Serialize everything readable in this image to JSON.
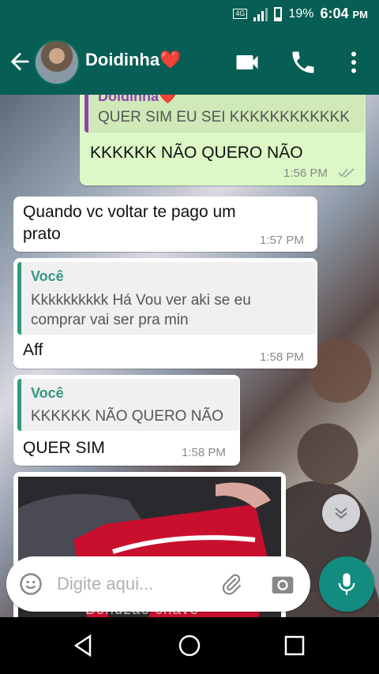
{
  "status_bar": {
    "network": "4G",
    "battery": "19%",
    "time": "6:04",
    "ampm": "PM"
  },
  "header": {
    "contact_name": "Doidinha❤️"
  },
  "messages": [
    {
      "type": "outgoing",
      "quote_author": "Doidinha❤️",
      "quote_text": "QUER SIM EU SEI KKKKKKKKKKKK",
      "text": "KKKKKK NÃO QUERO NÃO",
      "time": "1:56 PM",
      "read": true
    },
    {
      "type": "incoming",
      "text_line1": "Quando vc voltar te pago um",
      "text_line2": "prato",
      "time": "1:57 PM"
    },
    {
      "type": "incoming",
      "quote_author": "Você",
      "quote_line1": "Kkkkkkkkkk Há Vou ver aki se eu",
      "quote_line2": "comprar vai ser pra min",
      "text": "Aff",
      "time": "1:58 PM"
    },
    {
      "type": "incoming",
      "quote_author": "Você",
      "quote_text": "KKKKKK NÃO QUERO NÃO",
      "text": "QUER SIM",
      "time": "1:58 PM"
    }
  ],
  "composer": {
    "placeholder": "Digite aqui..."
  },
  "behind_text": "Bondzao chave",
  "icons": {
    "back": "arrow-left-icon",
    "video": "video-camera-icon",
    "call": "phone-icon",
    "menu": "more-vert-icon",
    "emoji": "emoji-icon",
    "attach": "paperclip-icon",
    "camera": "camera-icon",
    "mic": "microphone-icon"
  },
  "colors": {
    "header": "#075e54",
    "outgoing_bubble": "#dcf8c6",
    "incoming_bubble": "#ffffff",
    "accent": "#35987f",
    "mic_button": "#128c7e"
  }
}
